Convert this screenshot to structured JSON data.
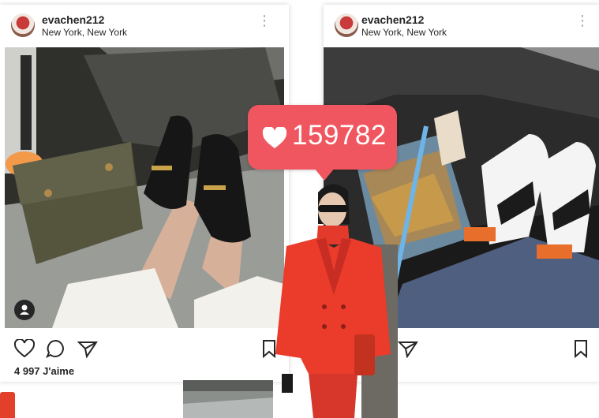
{
  "posts": [
    {
      "username": "evachen212",
      "location": "New York, New York",
      "likes_text": "4 997 J'aime",
      "icons": [
        "avatar",
        "more-icon",
        "heart-icon",
        "comment-icon",
        "share-icon",
        "bookmark-icon",
        "user-tag-icon"
      ]
    },
    {
      "username": "evachen212",
      "location": "New York, New York",
      "icons": [
        "avatar",
        "more-icon",
        "share-icon",
        "bookmark-icon"
      ]
    }
  ],
  "like_bubble": {
    "count": "159782",
    "icon": "heart-icon",
    "color": "#f0565f"
  },
  "colors": {
    "accent_red": "#e2402a",
    "text": "#262626"
  }
}
